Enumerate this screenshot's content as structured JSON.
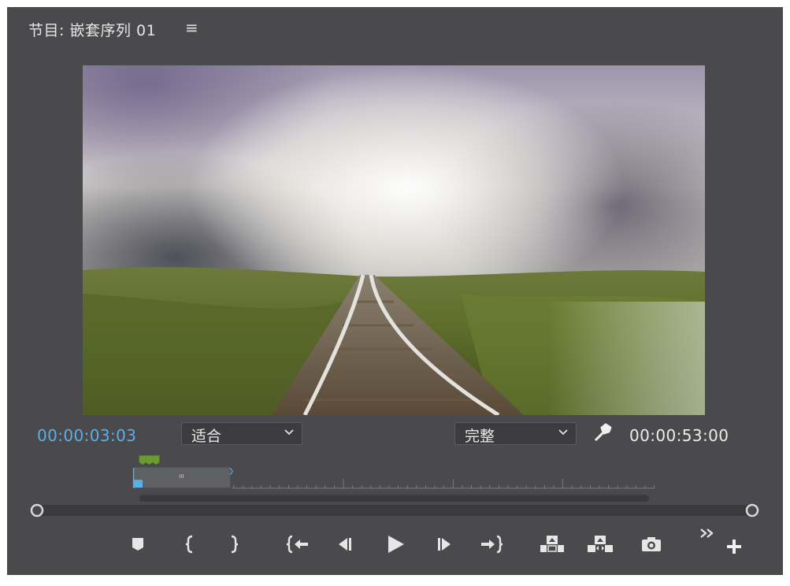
{
  "panel": {
    "title": "节目: 嵌套序列 01",
    "menu_glyph": "≡"
  },
  "timecode": {
    "current": "00:00:03:03",
    "duration": "00:00:53:00"
  },
  "zoom_select": {
    "selected": "适合",
    "arrow": "⌄"
  },
  "quality_select": {
    "selected": "完整",
    "arrow": "⌄"
  },
  "icons": {
    "menu": "hamburger-menu-icon",
    "settings": "wrench-icon",
    "marker": "add-marker-icon",
    "mark_in": "mark-in-icon",
    "mark_out": "mark-out-icon",
    "go_to_in": "go-to-in-icon",
    "step_back": "step-back-icon",
    "play": "play-icon",
    "step_forward": "step-forward-icon",
    "go_to_out": "go-to-out-icon",
    "lift": "lift-icon",
    "extract": "extract-icon",
    "export_frame": "camera-icon",
    "more": "double-chevron-right-icon",
    "add": "plus-icon"
  },
  "colors": {
    "panel_bg": "#4a4a4d",
    "current_timecode": "#5aafe6",
    "playhead": "#5aafe6",
    "marker": "#6b9b2e",
    "work_area": "#5f6064"
  },
  "timeline": {
    "playhead_position": 0.004,
    "work_area_start": 0.0,
    "work_area_end": 0.187,
    "scroll_start": 0.0,
    "scroll_end": 1.0
  }
}
